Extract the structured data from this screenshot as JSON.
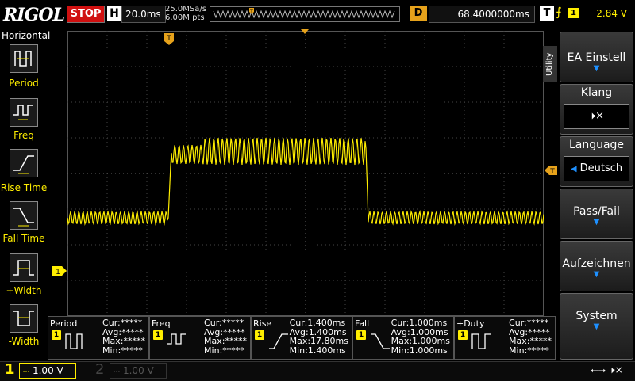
{
  "brand": "RIGOL",
  "run_state": "STOP",
  "horizontal": {
    "badge": "H",
    "timebase": "20.0ms",
    "sample_rate": "25.0MSa/s",
    "memory_depth": "6.00M pts"
  },
  "delay": {
    "badge": "D",
    "value": "68.4000000ms"
  },
  "trigger": {
    "badge": "T",
    "edge_icon": "rising-edge-icon",
    "channel": "1",
    "level": "2.84 V"
  },
  "left_menu": {
    "title": "Horizontal",
    "items": [
      {
        "label": "Period",
        "icon": "period-icon"
      },
      {
        "label": "Freq",
        "icon": "freq-icon"
      },
      {
        "label": "Rise Time",
        "icon": "rise-time-icon"
      },
      {
        "label": "Fall Time",
        "icon": "fall-time-icon"
      },
      {
        "label": "+Width",
        "icon": "pos-width-icon"
      },
      {
        "label": "-Width",
        "icon": "neg-width-icon"
      }
    ]
  },
  "right_menu": {
    "utility_tab": "Utility",
    "buttons": [
      {
        "label": "EA Einstell",
        "sub": ""
      },
      {
        "label": "Klang",
        "sub": ""
      },
      {
        "label": "Language",
        "sub": "Deutsch"
      },
      {
        "label": "Pass/Fail",
        "sub": ""
      },
      {
        "label": "Aufzeichnen",
        "sub": ""
      },
      {
        "label": "System",
        "sub": ""
      }
    ]
  },
  "markers": {
    "trigger_pos": "T",
    "trigger_level": "T",
    "ch1_ground": "1"
  },
  "measurements": [
    {
      "name": "Period",
      "ch": "1",
      "cur": "Cur:*****",
      "avg": "Avg:*****",
      "max": "Max:*****",
      "min": "Min:*****"
    },
    {
      "name": "Freq",
      "ch": "1",
      "cur": "Cur:*****",
      "avg": "Avg:*****",
      "max": "Max:*****",
      "min": "Min:*****"
    },
    {
      "name": "Rise",
      "ch": "1",
      "cur": "Cur:1.400ms",
      "avg": "Avg:1.400ms",
      "max": "Max:17.80ms",
      "min": "Min:1.400ms"
    },
    {
      "name": "Fall",
      "ch": "1",
      "cur": "Cur:1.000ms",
      "avg": "Avg:1.000ms",
      "max": "Max:1.000ms",
      "min": "Min:1.000ms"
    },
    {
      "name": "+Duty",
      "ch": "1",
      "cur": "Cur:*****",
      "avg": "Avg:*****",
      "max": "Max:*****",
      "min": "Min:*****"
    }
  ],
  "channels": [
    {
      "num": "1",
      "scale": "1.00 V",
      "active": true
    },
    {
      "num": "2",
      "scale": "1.00 V",
      "active": false
    }
  ],
  "colors": {
    "ch1": "#ffee00",
    "trigger": "#e6a21b",
    "stop": "#d01010",
    "menu_arrow": "#1e90ff"
  }
}
